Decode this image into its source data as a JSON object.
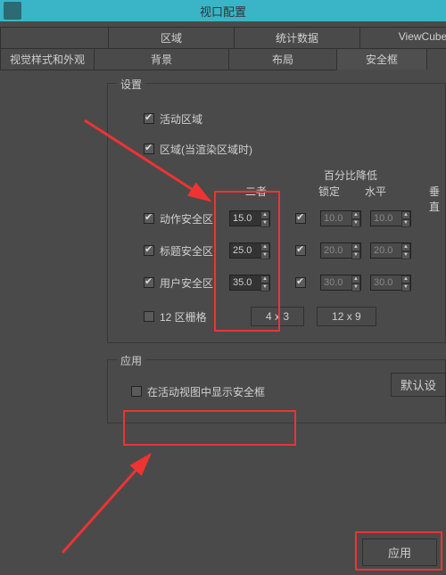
{
  "window": {
    "title": "视口配置"
  },
  "tabs": {
    "row1": [
      "区域",
      "统计数据",
      "ViewCube"
    ],
    "row2": [
      "视觉样式和外观",
      "背景",
      "布局",
      "安全框"
    ]
  },
  "settings": {
    "group_title": "设置",
    "active_zone": {
      "label": "活动区域",
      "checked": true
    },
    "zone_when_render": {
      "label": "区域(当渲染区域时)",
      "checked": true
    },
    "headers": {
      "pct_reduce": "百分比降低",
      "both": "二者",
      "lock": "锁定",
      "horiz": "水平",
      "vert": "垂直"
    },
    "rows": [
      {
        "label": "动作安全区",
        "checked": true,
        "both": "15.0",
        "locked": true,
        "h": "10.0",
        "v": "10.0"
      },
      {
        "label": "标题安全区",
        "checked": true,
        "both": "25.0",
        "locked": true,
        "h": "20.0",
        "v": "20.0"
      },
      {
        "label": "用户安全区",
        "checked": true,
        "both": "35.0",
        "locked": true,
        "h": "30.0",
        "v": "30.0"
      }
    ],
    "twelve_grid": {
      "label": "12 区栅格",
      "checked": false
    },
    "buttons": {
      "b43": "4 x 3",
      "b129": "12 x 9"
    }
  },
  "apply_group": {
    "title": "应用",
    "show_in_active": {
      "label": "在活动视图中显示安全框",
      "checked": false
    },
    "default_btn": "默认设"
  },
  "footer": {
    "apply": "应用"
  }
}
